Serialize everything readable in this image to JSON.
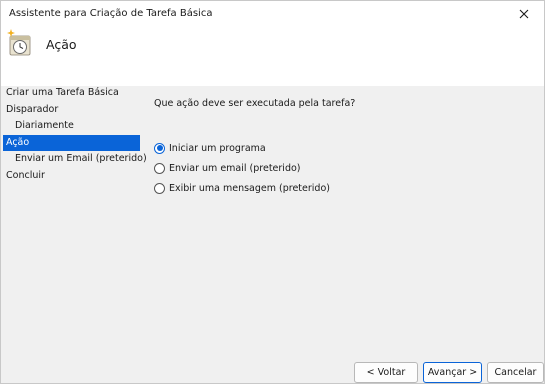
{
  "window": {
    "title": "Assistente para Criação de Tarefa Básica"
  },
  "header": {
    "title": "Ação",
    "icon": "task-scheduler-clock-icon"
  },
  "sidebar": {
    "items": [
      {
        "label": "Criar uma Tarefa Básica",
        "level": 0,
        "active": false
      },
      {
        "label": "Disparador",
        "level": 0,
        "active": false
      },
      {
        "label": "Diariamente",
        "level": 1,
        "active": false
      },
      {
        "label": "Ação",
        "level": 0,
        "active": true
      },
      {
        "label": "Enviar um Email (preterido)",
        "level": 1,
        "active": false
      },
      {
        "label": "Concluir",
        "level": 0,
        "active": false
      }
    ]
  },
  "main": {
    "question": "Que ação deve ser executada pela tarefa?",
    "options": [
      {
        "label": "Iniciar um programa",
        "checked": true
      },
      {
        "label": "Enviar um email (preterido)",
        "checked": false
      },
      {
        "label": "Exibir uma mensagem (preterido)",
        "checked": false
      }
    ]
  },
  "buttons": {
    "back": "< Voltar",
    "next": "Avançar >",
    "cancel": "Cancelar"
  },
  "colors": {
    "accent": "#0a64d8",
    "background": "#f0f0f0"
  }
}
